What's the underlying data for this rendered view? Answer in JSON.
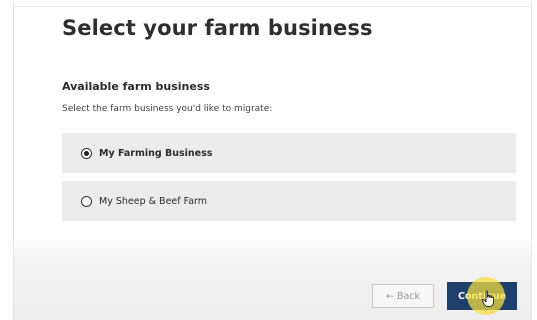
{
  "page": {
    "title": "Select your farm business"
  },
  "section": {
    "heading": "Available farm business",
    "description": "Select the farm business you'd like to migrate:"
  },
  "options": [
    {
      "label": "My Farming Business",
      "selected": true
    },
    {
      "label": "My Sheep & Beef Farm",
      "selected": false
    }
  ],
  "footer": {
    "back_arrow": "←",
    "back_label": "Back",
    "continue_label": "Continue"
  },
  "colors": {
    "primary_button": "#1e3f6c",
    "option_background": "#ececec",
    "cursor_highlight": "#f5e13c"
  },
  "icons": {
    "cursor": "hand-pointer-icon"
  }
}
